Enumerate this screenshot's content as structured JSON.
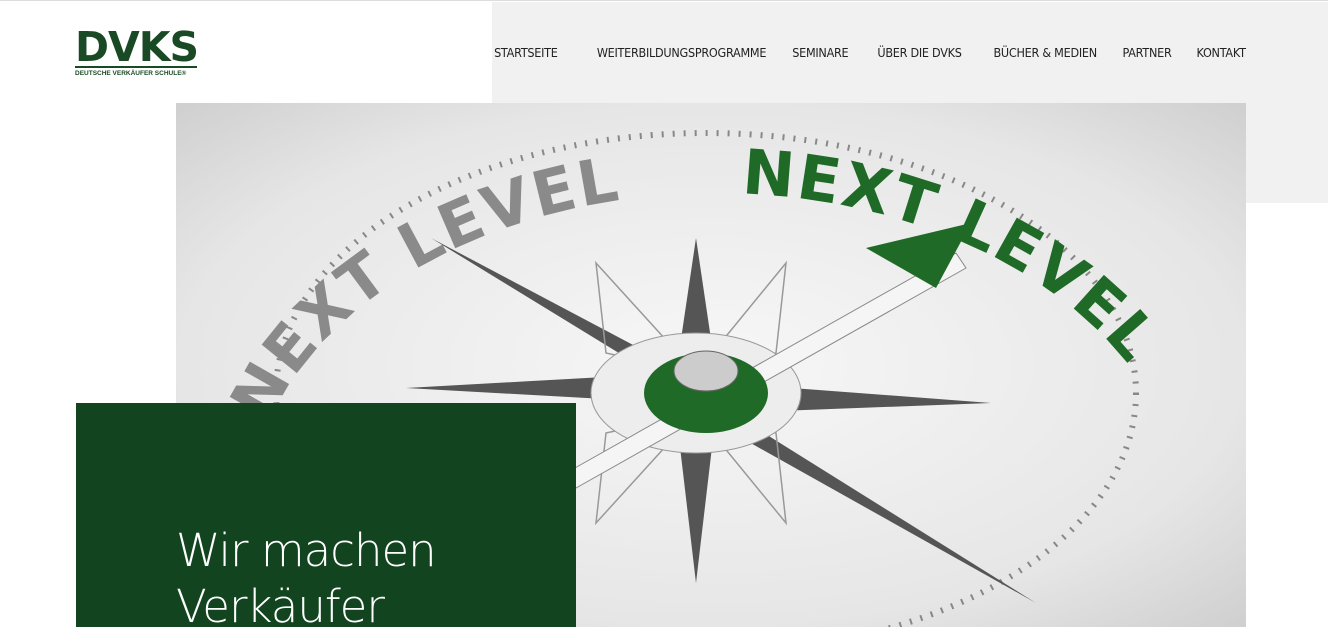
{
  "logo": {
    "title": "DVKS",
    "subtitle": "DEUTSCHE VERKÄUFER SCHULE®"
  },
  "nav": [
    {
      "label": "STARTSEITE"
    },
    {
      "label": "WEITERBILDUNGSPROGRAMME"
    },
    {
      "label": "SEMINARE"
    },
    {
      "label": "ÜBER DIE DVKS"
    },
    {
      "label": "BÜCHER & MEDIEN"
    },
    {
      "label": "PARTNER"
    },
    {
      "label": "KONTAKT"
    }
  ],
  "hero": {
    "image_text": "NEXT LEVEL",
    "headline_line1": "Wir machen",
    "headline_line2": "Verkäufer"
  },
  "colors": {
    "brand_green": "#12441f",
    "needle_green": "#1f6a26",
    "panel_gray": "#f1f1f1"
  }
}
